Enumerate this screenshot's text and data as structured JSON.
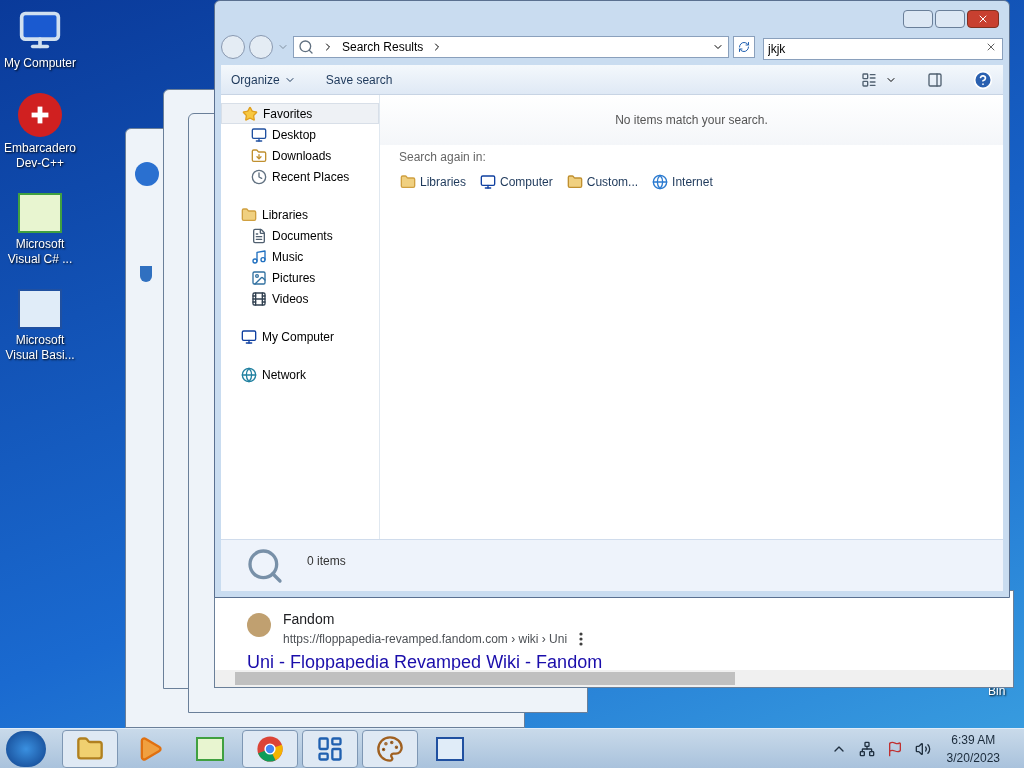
{
  "desktop_icons": [
    {
      "kind": "computer",
      "label": "My Computer"
    },
    {
      "kind": "devcpp",
      "label": "Embarcadero Dev-C++"
    },
    {
      "kind": "csharp",
      "label": "Microsoft Visual C# ..."
    },
    {
      "kind": "vb",
      "label": "Microsoft Visual Basi..."
    }
  ],
  "desktop_edge_label": "Bin",
  "explorer": {
    "address": "Search Results",
    "search_value": "jkjk",
    "toolbar": [
      "Organize",
      "Save search"
    ],
    "nav": [
      {
        "kind": "star",
        "label": "Favorites",
        "selected": true,
        "children": [
          {
            "kind": "desktop",
            "label": "Desktop",
            "selected": false
          },
          {
            "kind": "downloads",
            "label": "Downloads",
            "selected": false
          },
          {
            "kind": "recent",
            "label": "Recent Places",
            "selected": false
          }
        ]
      },
      {
        "kind": "libraries",
        "label": "Libraries",
        "selected": false,
        "children": [
          {
            "kind": "documents",
            "label": "Documents",
            "selected": false
          },
          {
            "kind": "music",
            "label": "Music",
            "selected": false
          },
          {
            "kind": "pictures",
            "label": "Pictures",
            "selected": false
          },
          {
            "kind": "videos",
            "label": "Videos",
            "selected": false
          }
        ]
      },
      {
        "kind": "computer",
        "label": "My Computer",
        "selected": false
      },
      {
        "kind": "network",
        "label": "Network",
        "selected": false
      }
    ],
    "message": "No items match your search.",
    "search_again_label": "Search again in:",
    "search_locations": [
      {
        "kind": "libraries",
        "label": "Libraries"
      },
      {
        "kind": "computer",
        "label": "Computer"
      },
      {
        "kind": "custom",
        "label": "Custom..."
      },
      {
        "kind": "internet",
        "label": "Internet"
      }
    ],
    "status": "0 items"
  },
  "browser": {
    "site": "Fandom",
    "url": "https://floppapedia-revamped.fandom.com › wiki › Uni",
    "title": "Uni - Floppapedia Revamped Wiki - Fandom"
  },
  "taskbar": {
    "apps": [
      {
        "kind": "explorer",
        "active": true
      },
      {
        "kind": "media",
        "active": false
      },
      {
        "kind": "csharp",
        "active": false
      },
      {
        "kind": "chrome",
        "active": true
      },
      {
        "kind": "panel",
        "active": true
      },
      {
        "kind": "paint",
        "active": true
      },
      {
        "kind": "vb",
        "active": false
      }
    ],
    "time": "6:39 AM",
    "date": "3/20/2023"
  }
}
